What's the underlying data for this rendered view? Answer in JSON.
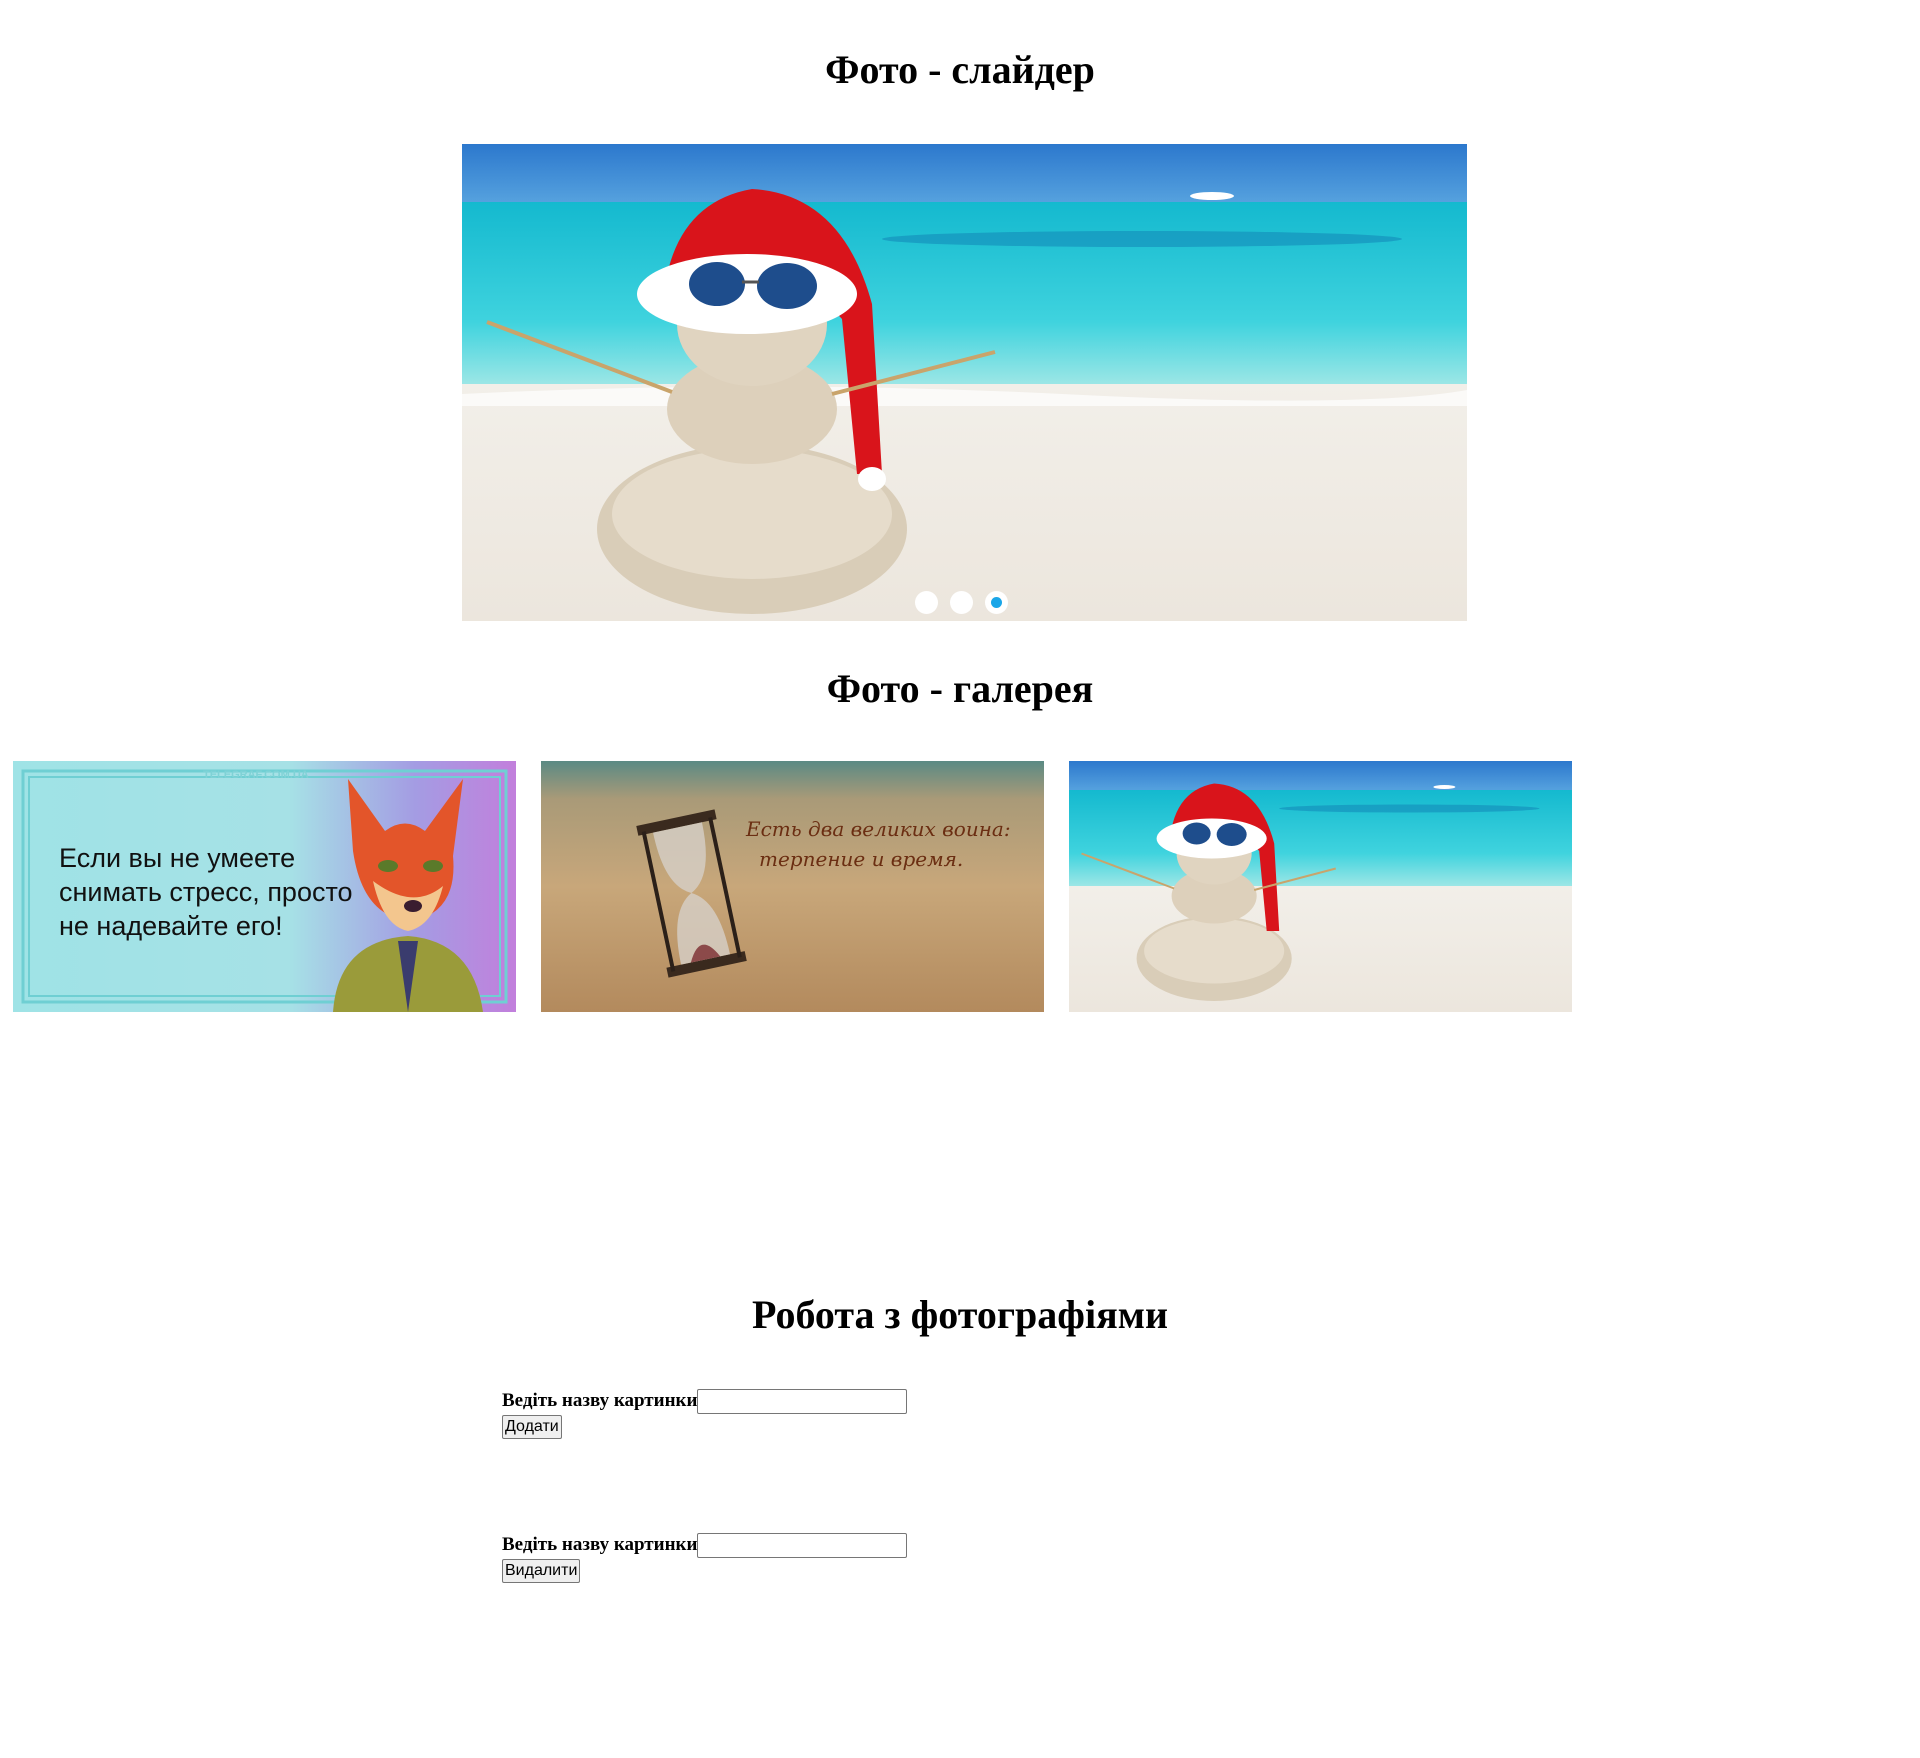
{
  "slider": {
    "title": "Фото - слайдер",
    "dots": [
      {
        "active": false
      },
      {
        "active": false
      },
      {
        "active": true
      }
    ],
    "image": "sand-snowman-beach-photo"
  },
  "gallery": {
    "title": "Фото - галерея",
    "items": [
      {
        "image": "fox-meme-card",
        "watermark": "TELEGRAF.COM.UA",
        "caption_lines": [
          "Если вы не умеете",
          "снимать стресс, просто",
          "не надевайте его!"
        ]
      },
      {
        "image": "hourglass-in-sand",
        "caption_lines": [
          "Есть два великих воина:",
          "терпение и время."
        ]
      },
      {
        "image": "sand-snowman-beach-photo"
      }
    ]
  },
  "photo_tools": {
    "title": "Робота з фотографіями",
    "add_form": {
      "label": "Ведіть назву картинки",
      "value": "",
      "button": "Додати"
    },
    "delete_form": {
      "label": "Ведіть назву картинки",
      "value": "",
      "button": "Видалити"
    }
  },
  "colors": {
    "active_dot": "#1aa6e8",
    "sea": "#19c2cf",
    "sky": "#2f7fd0",
    "hat": "#d9141b"
  }
}
